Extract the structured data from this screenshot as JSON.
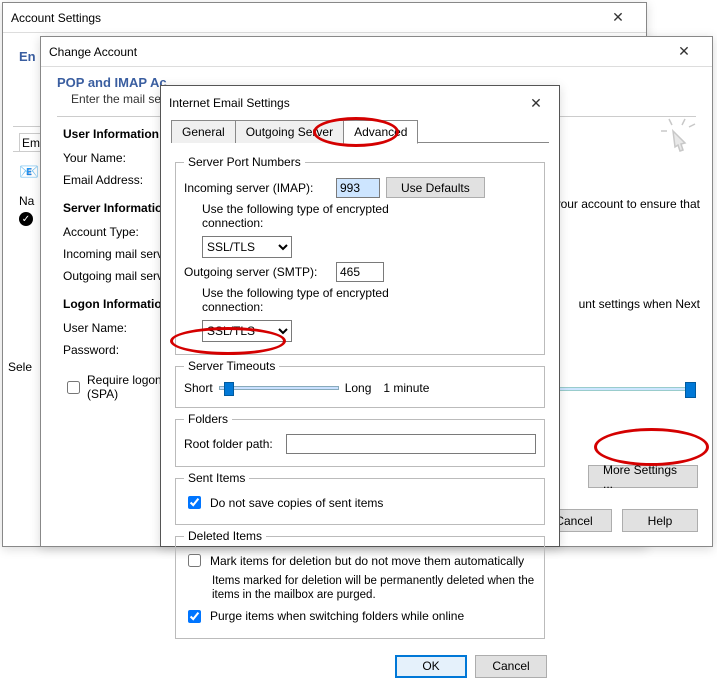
{
  "account_settings": {
    "title": "Account Settings",
    "tab_email": "Email",
    "en_prefix": "En",
    "name_label": "Na",
    "selected_label": "Sele"
  },
  "change_account": {
    "title": "Change Account",
    "subtitle": "POP and IMAP Ac",
    "subdesc": "Enter the mail se",
    "cursor_hint": "✲",
    "right_text_1": "your account to ensure that",
    "right_text_2": "unt settings when Next",
    "sections": {
      "user_info": "User Information",
      "your_name": "Your Name:",
      "email_address": "Email Address:",
      "server_info": "Server Information",
      "account_type": "Account Type:",
      "incoming": "Incoming mail serve",
      "outgoing": "Outgoing mail serve",
      "logon_info": "Logon Information",
      "username": "User Name:",
      "password": "Password:",
      "spa": "Require logon us (SPA)"
    },
    "buttons": {
      "more_settings": "More Settings ...",
      "cancel": "Cancel",
      "help": "Help"
    }
  },
  "ies": {
    "title": "Internet Email Settings",
    "tabs": {
      "general": "General",
      "outgoing": "Outgoing Server",
      "advanced": "Advanced"
    },
    "fs_ports": "Server Port Numbers",
    "incoming_label": "Incoming server (IMAP):",
    "incoming_port": "993",
    "use_defaults": "Use Defaults",
    "enc_label": "Use the following type of encrypted connection:",
    "enc_value": "SSL/TLS",
    "outgoing_label": "Outgoing server (SMTP):",
    "outgoing_port": "465",
    "fs_timeouts": "Server Timeouts",
    "short": "Short",
    "long": "Long",
    "timeout_val": "1 minute",
    "fs_folders": "Folders",
    "root_folder": "Root folder path:",
    "fs_sent": "Sent Items",
    "sent_cb": "Do not save copies of sent items",
    "fs_deleted": "Deleted Items",
    "del_cb1": "Mark items for deletion but do not move them automatically",
    "del_note": "Items marked for deletion will be permanently deleted when the items in the mailbox are purged.",
    "del_cb2": "Purge items when switching folders while online",
    "ok": "OK",
    "cancel": "Cancel"
  }
}
